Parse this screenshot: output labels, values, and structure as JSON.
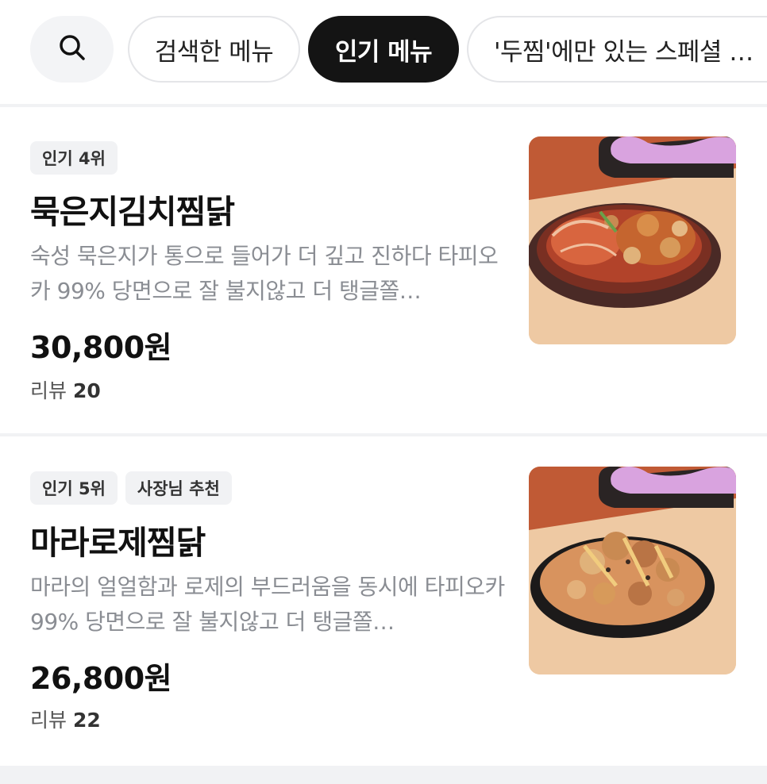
{
  "filters": {
    "search_icon": "search-icon",
    "chips": [
      {
        "label": "검색한 메뉴",
        "active": false
      },
      {
        "label": "인기 메뉴",
        "active": true
      },
      {
        "label": "'두찜'에만 있는 스페셜 …",
        "active": false
      }
    ]
  },
  "menu_items": [
    {
      "tags": [
        "인기 4위"
      ],
      "name": "묵은지김치찜닭",
      "description": "숙성 묵은지가 통으로 들어가 더 깊고 진하다  타피오카 99% 당면으로 잘 불지않고 더 탱글쫄…",
      "price": "30,800원",
      "review_label": "리뷰",
      "review_count": "20",
      "image": "kimchi-jjimdak-photo"
    },
    {
      "tags": [
        "인기 5위",
        "사장님 추천"
      ],
      "name": "마라로제찜닭",
      "description": "마라의 얼얼함과 로제의 부드러움을 동시에   타피오카 99% 당면으로 잘 불지않고 더 탱글쫄…",
      "price": "26,800원",
      "review_label": "리뷰",
      "review_count": "22",
      "image": "mala-rose-jjimdak-photo"
    }
  ],
  "colors": {
    "active_chip_bg": "#141414",
    "tag_bg": "#f1f2f4",
    "description_text": "#8a8d93",
    "thumb_wall": "#c05a35",
    "thumb_table": "#eec9a3",
    "container_lid": "#d9a3df"
  }
}
